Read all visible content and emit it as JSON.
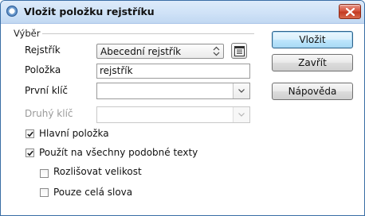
{
  "window": {
    "title": "Vložit položku rejstříku"
  },
  "group": {
    "label": "Výběr"
  },
  "fields": {
    "rejstrik": {
      "label": "Rejstřík",
      "value": "Abecední rejstřík"
    },
    "polozka": {
      "label": "Položka",
      "value": "rejstřík"
    },
    "prvni_klic": {
      "label": "První klíč",
      "value": ""
    },
    "druhy_klic": {
      "label": "Druhý klíč",
      "value": "",
      "disabled": true
    }
  },
  "checkboxes": {
    "hlavni_polozka": {
      "label": "Hlavní položka",
      "checked": true
    },
    "pouzit_na_vsechny": {
      "label": "Použít na všechny podobné texty",
      "checked": true
    },
    "rozlisovat_velikost": {
      "label": "Rozlišovat velikost",
      "checked": false
    },
    "pouze_cela_slova": {
      "label": "Pouze celá slova",
      "checked": false
    }
  },
  "buttons": {
    "vlozit": "Vložit",
    "zavrit": "Zavřít",
    "napoveda": "Nápověda"
  },
  "icons": {
    "app": "app-icon",
    "close": "close-icon",
    "new_index": "new-index-icon",
    "spin": "spin-updown-icon",
    "dropdown": "chevron-down-icon",
    "check": "checkmark-icon"
  }
}
